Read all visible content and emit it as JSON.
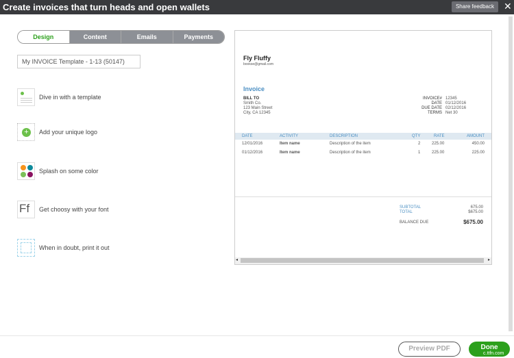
{
  "header": {
    "title": "Create invoices that turn heads and open wallets",
    "feedback": "Share feedback",
    "close": "✕"
  },
  "tabs": [
    {
      "label": "Design",
      "active": true
    },
    {
      "label": "Content"
    },
    {
      "label": "Emails"
    },
    {
      "label": "Payments"
    }
  ],
  "template_name": "My INVOICE Template - 1-13 (50147)",
  "options": [
    {
      "label": "Dive in with a template",
      "icon": "template-icon"
    },
    {
      "label": "Add your unique logo",
      "icon": "add-logo-icon"
    },
    {
      "label": "Splash on some color",
      "icon": "color-palette-icon"
    },
    {
      "label": "Get choosy with your font",
      "icon": "font-icon"
    },
    {
      "label": "When in doubt, print it out",
      "icon": "print-icon"
    }
  ],
  "invoice": {
    "company": "Fly Fluffy",
    "email": "booksе@gmail.com",
    "title": "Invoice",
    "bill_to_label": "BILL TO",
    "bill_to": [
      "Smith Co.",
      "123 Main Street",
      "City, CA 12345"
    ],
    "meta": [
      {
        "k": "INVOICE#",
        "v": "12345"
      },
      {
        "k": "DATE",
        "v": "01/12/2016"
      },
      {
        "k": "DUE DATE",
        "v": "02/12/2016"
      },
      {
        "k": "TERMS",
        "v": "Net 30"
      }
    ],
    "columns": [
      "DATE",
      "ACTIVITY",
      "DESCRIPTION",
      "QTY",
      "RATE",
      "AMOUNT"
    ],
    "rows": [
      [
        "12/01/2016",
        "Item name",
        "Description of the item",
        "2",
        "225.00",
        "450.00"
      ],
      [
        "01/12/2016",
        "Item name",
        "Description of the item",
        "1",
        "225.00",
        "225.00"
      ]
    ],
    "subtotal_label": "SUBTOTAL",
    "subtotal": "675.00",
    "total_label": "TOTAL",
    "total": "$675.00",
    "balance_label": "BALANCE DUE",
    "balance": "$675.00"
  },
  "footer": {
    "preview": "Preview PDF",
    "done": "Done"
  },
  "watermark": "c.ttfn.com",
  "colors": {
    "accent": "#2ca01c",
    "link": "#4a8ec2"
  }
}
